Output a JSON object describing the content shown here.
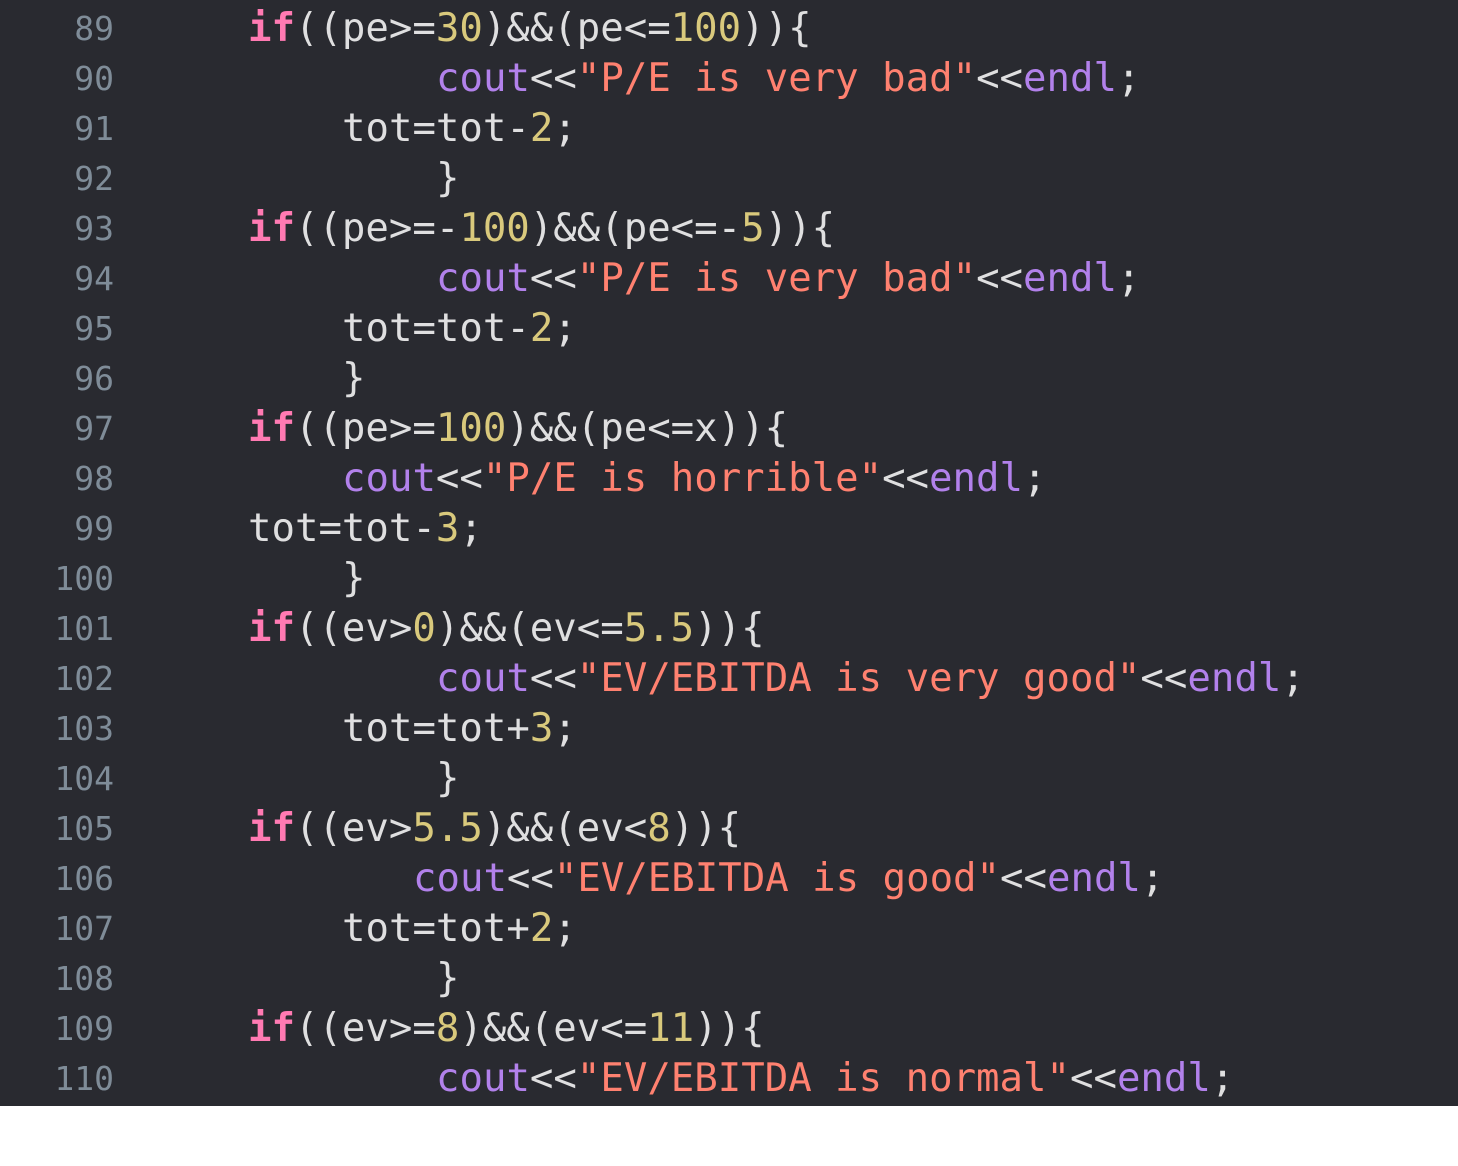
{
  "editor": {
    "lines": [
      {
        "number": "89",
        "tokens": [
          {
            "t": "kw",
            "v": "if"
          },
          {
            "t": "pl",
            "v": "((pe>="
          },
          {
            "t": "num",
            "v": "30"
          },
          {
            "t": "pl",
            "v": ")&&(pe<="
          },
          {
            "t": "num",
            "v": "100"
          },
          {
            "t": "pl",
            "v": ")){"
          }
        ]
      },
      {
        "number": "90",
        "tokens": [
          {
            "t": "fn",
            "v": "cout"
          },
          {
            "t": "pl",
            "v": "<<"
          },
          {
            "t": "str",
            "v": "\"P/E is very bad\""
          },
          {
            "t": "pl",
            "v": "<<"
          },
          {
            "t": "fn",
            "v": "endl"
          },
          {
            "t": "pl",
            "v": ";"
          }
        ]
      },
      {
        "number": "91",
        "tokens": [
          {
            "t": "pl",
            "v": "tot=tot-"
          },
          {
            "t": "num",
            "v": "2"
          },
          {
            "t": "pl",
            "v": ";"
          }
        ]
      },
      {
        "number": "92",
        "tokens": [
          {
            "t": "pl",
            "v": "}"
          }
        ]
      },
      {
        "number": "93",
        "tokens": [
          {
            "t": "kw",
            "v": "if"
          },
          {
            "t": "pl",
            "v": "((pe>=-"
          },
          {
            "t": "num",
            "v": "100"
          },
          {
            "t": "pl",
            "v": ")&&(pe<=-"
          },
          {
            "t": "num",
            "v": "5"
          },
          {
            "t": "pl",
            "v": ")){"
          }
        ]
      },
      {
        "number": "94",
        "tokens": [
          {
            "t": "fn",
            "v": "cout"
          },
          {
            "t": "pl",
            "v": "<<"
          },
          {
            "t": "str",
            "v": "\"P/E is very bad\""
          },
          {
            "t": "pl",
            "v": "<<"
          },
          {
            "t": "fn",
            "v": "endl"
          },
          {
            "t": "pl",
            "v": ";"
          }
        ]
      },
      {
        "number": "95",
        "tokens": [
          {
            "t": "pl",
            "v": "tot=tot-"
          },
          {
            "t": "num",
            "v": "2"
          },
          {
            "t": "pl",
            "v": ";"
          }
        ]
      },
      {
        "number": "96",
        "tokens": [
          {
            "t": "pl",
            "v": "}"
          }
        ]
      },
      {
        "number": "97",
        "tokens": [
          {
            "t": "kw",
            "v": "if"
          },
          {
            "t": "pl",
            "v": "((pe>="
          },
          {
            "t": "num",
            "v": "100"
          },
          {
            "t": "pl",
            "v": ")&&(pe<=x)){"
          }
        ]
      },
      {
        "number": "98",
        "tokens": [
          {
            "t": "fn",
            "v": "cout"
          },
          {
            "t": "pl",
            "v": "<<"
          },
          {
            "t": "str",
            "v": "\"P/E is horrible\""
          },
          {
            "t": "pl",
            "v": "<<"
          },
          {
            "t": "fn",
            "v": "endl"
          },
          {
            "t": "pl",
            "v": ";"
          }
        ]
      },
      {
        "number": "99",
        "tokens": [
          {
            "t": "pl",
            "v": "tot=tot-"
          },
          {
            "t": "num",
            "v": "3"
          },
          {
            "t": "pl",
            "v": ";"
          }
        ]
      },
      {
        "number": "100",
        "tokens": [
          {
            "t": "pl",
            "v": "}"
          }
        ]
      },
      {
        "number": "101",
        "tokens": [
          {
            "t": "kw",
            "v": "if"
          },
          {
            "t": "pl",
            "v": "((ev>"
          },
          {
            "t": "num",
            "v": "0"
          },
          {
            "t": "pl",
            "v": ")&&(ev<="
          },
          {
            "t": "num",
            "v": "5.5"
          },
          {
            "t": "pl",
            "v": ")){"
          }
        ]
      },
      {
        "number": "102",
        "tokens": [
          {
            "t": "fn",
            "v": "cout"
          },
          {
            "t": "pl",
            "v": "<<"
          },
          {
            "t": "str",
            "v": "\"EV/EBITDA is very good\""
          },
          {
            "t": "pl",
            "v": "<<"
          },
          {
            "t": "fn",
            "v": "endl"
          },
          {
            "t": "pl",
            "v": ";"
          }
        ]
      },
      {
        "number": "103",
        "tokens": [
          {
            "t": "pl",
            "v": "tot=tot+"
          },
          {
            "t": "num",
            "v": "3"
          },
          {
            "t": "pl",
            "v": ";"
          }
        ]
      },
      {
        "number": "104",
        "tokens": [
          {
            "t": "pl",
            "v": "}"
          }
        ]
      },
      {
        "number": "105",
        "tokens": [
          {
            "t": "kw",
            "v": "if"
          },
          {
            "t": "pl",
            "v": "((ev>"
          },
          {
            "t": "num",
            "v": "5.5"
          },
          {
            "t": "pl",
            "v": ")&&(ev<"
          },
          {
            "t": "num",
            "v": "8"
          },
          {
            "t": "pl",
            "v": ")){"
          }
        ]
      },
      {
        "number": "106",
        "tokens": [
          {
            "t": "fn",
            "v": "cout"
          },
          {
            "t": "pl",
            "v": "<<"
          },
          {
            "t": "str",
            "v": "\"EV/EBITDA is good\""
          },
          {
            "t": "pl",
            "v": "<<"
          },
          {
            "t": "fn",
            "v": "endl"
          },
          {
            "t": "pl",
            "v": ";"
          }
        ]
      },
      {
        "number": "107",
        "tokens": [
          {
            "t": "pl",
            "v": "tot=tot+"
          },
          {
            "t": "num",
            "v": "2"
          },
          {
            "t": "pl",
            "v": ";"
          }
        ]
      },
      {
        "number": "108",
        "tokens": [
          {
            "t": "pl",
            "v": "}"
          }
        ]
      },
      {
        "number": "109",
        "tokens": [
          {
            "t": "kw",
            "v": "if"
          },
          {
            "t": "pl",
            "v": "((ev>="
          },
          {
            "t": "num",
            "v": "8"
          },
          {
            "t": "pl",
            "v": ")&&(ev<="
          },
          {
            "t": "num",
            "v": "11"
          },
          {
            "t": "pl",
            "v": ")){"
          }
        ]
      },
      {
        "number": "110",
        "tokens": [
          {
            "t": "fn",
            "v": "cout"
          },
          {
            "t": "pl",
            "v": "<<"
          },
          {
            "t": "str",
            "v": "\"EV/EBITDA is normal\""
          },
          {
            "t": "pl",
            "v": "<<"
          },
          {
            "t": "fn",
            "v": "endl"
          },
          {
            "t": "pl",
            "v": ";"
          }
        ]
      }
    ]
  },
  "theme": {
    "background": "#292a30",
    "keyword": "#ff7ab2",
    "number": "#d9c97c",
    "string": "#ff8170",
    "identifier": "#b281eb",
    "plain": "#dfdfe0",
    "line_number": "#7f8c98"
  }
}
